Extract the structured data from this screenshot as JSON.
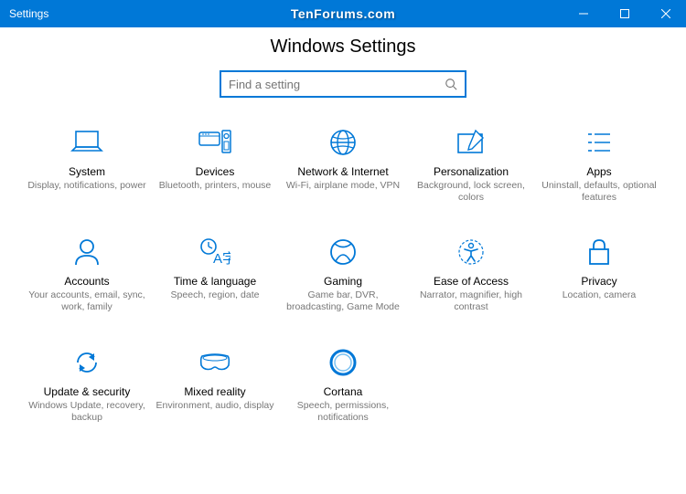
{
  "window": {
    "title": "Settings",
    "watermark": "TenForums.com"
  },
  "header": {
    "page_title": "Windows Settings",
    "search_placeholder": "Find a setting"
  },
  "tiles": [
    {
      "icon": "laptop-icon",
      "label": "System",
      "desc": "Display, notifications, power"
    },
    {
      "icon": "devices-icon",
      "label": "Devices",
      "desc": "Bluetooth, printers, mouse"
    },
    {
      "icon": "globe-icon",
      "label": "Network & Internet",
      "desc": "Wi-Fi, airplane mode, VPN"
    },
    {
      "icon": "paint-icon",
      "label": "Personalization",
      "desc": "Background, lock screen, colors"
    },
    {
      "icon": "apps-icon",
      "label": "Apps",
      "desc": "Uninstall, defaults, optional features"
    },
    {
      "icon": "person-icon",
      "label": "Accounts",
      "desc": "Your accounts, email, sync, work, family"
    },
    {
      "icon": "timelang-icon",
      "label": "Time & language",
      "desc": "Speech, region, date"
    },
    {
      "icon": "xbox-icon",
      "label": "Gaming",
      "desc": "Game bar, DVR, broadcasting, Game Mode"
    },
    {
      "icon": "ease-icon",
      "label": "Ease of Access",
      "desc": "Narrator, magnifier, high contrast"
    },
    {
      "icon": "lock-icon",
      "label": "Privacy",
      "desc": "Location, camera"
    },
    {
      "icon": "update-icon",
      "label": "Update & security",
      "desc": "Windows Update, recovery, backup"
    },
    {
      "icon": "headset-icon",
      "label": "Mixed reality",
      "desc": "Environment, audio, display"
    },
    {
      "icon": "cortana-icon",
      "label": "Cortana",
      "desc": "Speech, permissions, notifications"
    }
  ]
}
